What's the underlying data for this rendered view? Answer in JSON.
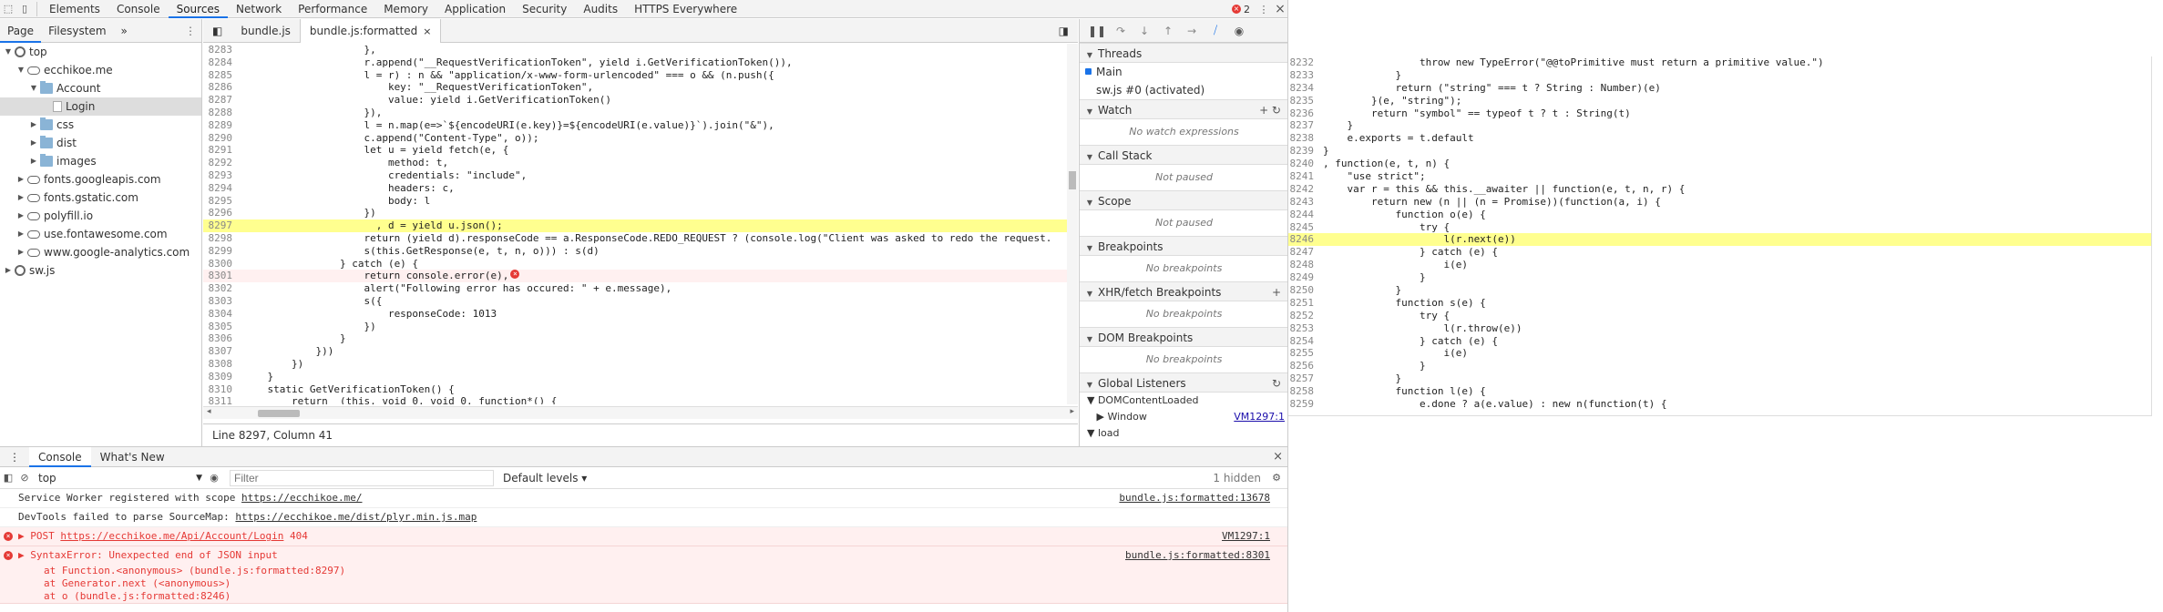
{
  "tabs": [
    "Elements",
    "Console",
    "Sources",
    "Network",
    "Performance",
    "Memory",
    "Application",
    "Security",
    "Audits",
    "HTTPS Everywhere"
  ],
  "active_tab": "Sources",
  "error_count": "2",
  "navigator": {
    "tabs": [
      "Page",
      "Filesystem"
    ],
    "more": "»",
    "tree": [
      {
        "label": "top",
        "depth": 0,
        "icon": "gear-icon",
        "open": true
      },
      {
        "label": "ecchikoe.me",
        "depth": 1,
        "icon": "cloud-icon",
        "open": true
      },
      {
        "label": "Account",
        "depth": 2,
        "icon": "folder-icon",
        "open": true
      },
      {
        "label": "Login",
        "depth": 3,
        "icon": "file-icon",
        "open": false,
        "selected": true
      },
      {
        "label": "css",
        "depth": 2,
        "icon": "folder-icon",
        "open": false
      },
      {
        "label": "dist",
        "depth": 2,
        "icon": "folder-icon",
        "open": false
      },
      {
        "label": "images",
        "depth": 2,
        "icon": "folder-icon",
        "open": false
      },
      {
        "label": "fonts.googleapis.com",
        "depth": 1,
        "icon": "cloud-icon",
        "open": false
      },
      {
        "label": "fonts.gstatic.com",
        "depth": 1,
        "icon": "cloud-icon",
        "open": false
      },
      {
        "label": "polyfill.io",
        "depth": 1,
        "icon": "cloud-icon",
        "open": false
      },
      {
        "label": "use.fontawesome.com",
        "depth": 1,
        "icon": "cloud-icon",
        "open": false
      },
      {
        "label": "www.google-analytics.com",
        "depth": 1,
        "icon": "cloud-icon",
        "open": false
      },
      {
        "label": "sw.js",
        "depth": 0,
        "icon": "gear-icon",
        "open": false
      }
    ]
  },
  "editor": {
    "tabs": [
      {
        "label": "bundle.js",
        "active": false
      },
      {
        "label": "bundle.js:formatted",
        "active": true,
        "close": "×"
      }
    ],
    "status": "Line 8297, Column 41",
    "lines": [
      {
        "n": "8283",
        "t": "                    },"
      },
      {
        "n": "8284",
        "t": "                    r.append(\"__RequestVerificationToken\", yield i.GetVerificationToken()),"
      },
      {
        "n": "8285",
        "t": "                    l = r) : n && \"application/x-www-form-urlencoded\" === o && (n.push({"
      },
      {
        "n": "8286",
        "t": "                        key: \"__RequestVerificationToken\","
      },
      {
        "n": "8287",
        "t": "                        value: yield i.GetVerificationToken()"
      },
      {
        "n": "8288",
        "t": "                    }),"
      },
      {
        "n": "8289",
        "t": "                    l = n.map(e=>`${encodeURI(e.key)}=${encodeURI(e.value)}`).join(\"&\"),"
      },
      {
        "n": "8290",
        "t": "                    c.append(\"Content-Type\", o));"
      },
      {
        "n": "8291",
        "t": "                    let u = yield fetch(e, {"
      },
      {
        "n": "8292",
        "t": "                        method: t,"
      },
      {
        "n": "8293",
        "t": "                        credentials: \"include\","
      },
      {
        "n": "8294",
        "t": "                        headers: c,"
      },
      {
        "n": "8295",
        "t": "                        body: l"
      },
      {
        "n": "8296",
        "t": "                    })"
      },
      {
        "n": "8297",
        "t": "                      , d = yield u.json();",
        "hl": true
      },
      {
        "n": "8298",
        "t": "                    return (yield d).responseCode == a.ResponseCode.REDO_REQUEST ? (console.log(\"Client was asked to redo the request."
      },
      {
        "n": "8299",
        "t": "                    s(this.GetResponse(e, t, n, o))) : s(d)"
      },
      {
        "n": "8300",
        "t": "                } catch (e) {"
      },
      {
        "n": "8301",
        "t": "                    return console.error(e),",
        "err": true
      },
      {
        "n": "8302",
        "t": "                    alert(\"Following error has occured: \" + e.message),"
      },
      {
        "n": "8303",
        "t": "                    s({"
      },
      {
        "n": "8304",
        "t": "                        responseCode: 1013"
      },
      {
        "n": "8305",
        "t": "                    })"
      },
      {
        "n": "8306",
        "t": "                }"
      },
      {
        "n": "8307",
        "t": "            }))"
      },
      {
        "n": "8308",
        "t": "        })"
      },
      {
        "n": "8309",
        "t": "    }"
      },
      {
        "n": "8310",
        "t": "    static GetVerificationToken() {"
      },
      {
        "n": "8311",
        "t": "        return _(this, void 0, void 0, function*() {"
      }
    ]
  },
  "debugger": {
    "threads_title": "Threads",
    "threads": [
      "Main",
      "sw.js #0 (activated)"
    ],
    "sections": [
      {
        "title": "Watch",
        "empty": "No watch expressions",
        "actions": "+ ↻"
      },
      {
        "title": "Call Stack",
        "empty": "Not paused",
        "actions": ""
      },
      {
        "title": "Scope",
        "empty": "Not paused",
        "actions": ""
      },
      {
        "title": "Breakpoints",
        "empty": "No breakpoints",
        "actions": ""
      },
      {
        "title": "XHR/fetch Breakpoints",
        "empty": "No breakpoints",
        "actions": "+"
      },
      {
        "title": "DOM Breakpoints",
        "empty": "No breakpoints",
        "actions": ""
      }
    ],
    "global_title": "Global Listeners",
    "global": [
      {
        "label": "▼ DOMContentLoaded",
        "link": ""
      },
      {
        "label": "   ▶ Window",
        "link": "VM1297:1"
      },
      {
        "label": "▼ load",
        "link": ""
      }
    ]
  },
  "drawer": {
    "tabs": [
      "Console",
      "What's New"
    ],
    "context": "top",
    "filter_placeholder": "Filter",
    "levels": "Default levels ▾",
    "hidden": "1 hidden",
    "messages": [
      {
        "type": "info",
        "prefix": "Service Worker registered with scope ",
        "link": "https://ecchikoe.me/",
        "suffix": "",
        "src": "bundle.js:formatted:13678"
      },
      {
        "type": "warn",
        "prefix": "DevTools failed to parse SourceMap: ",
        "link": "https://ecchikoe.me/dist/plyr.min.js.map",
        "suffix": "",
        "src": ""
      },
      {
        "type": "error",
        "prefix": "▶ POST ",
        "link": "https://ecchikoe.me/Api/Account/Login",
        "suffix": " 404",
        "src": "VM1297:1"
      },
      {
        "type": "error",
        "prefix": "▶ SyntaxError: Unexpected end of JSON input",
        "link": "",
        "suffix": "",
        "src": "bundle.js:formatted:8301",
        "stack": [
          "at Function.<anonymous> (bundle.js:formatted:8297)",
          "at Generator.next (<anonymous>)",
          "at o (bundle.js:formatted:8246)"
        ]
      }
    ]
  },
  "pane2": {
    "lines": [
      {
        "n": "8232",
        "t": "                throw new TypeError(\"@@toPrimitive must return a primitive value.\")"
      },
      {
        "n": "8233",
        "t": "            }"
      },
      {
        "n": "8234",
        "t": "            return (\"string\" === t ? String : Number)(e)"
      },
      {
        "n": "8235",
        "t": "        }(e, \"string\");"
      },
      {
        "n": "8236",
        "t": "        return \"symbol\" == typeof t ? t : String(t)"
      },
      {
        "n": "8237",
        "t": "    }"
      },
      {
        "n": "8238",
        "t": "    e.exports = t.default"
      },
      {
        "n": "8239",
        "t": "}"
      },
      {
        "n": "8240",
        "t": ", function(e, t, n) {"
      },
      {
        "n": "8241",
        "t": "    \"use strict\";"
      },
      {
        "n": "8242",
        "t": "    var r = this && this.__awaiter || function(e, t, n, r) {"
      },
      {
        "n": "8243",
        "t": "        return new (n || (n = Promise))(function(a, i) {"
      },
      {
        "n": "8244",
        "t": "            function o(e) {"
      },
      {
        "n": "8245",
        "t": "                try {"
      },
      {
        "n": "8246",
        "t": "                    l(r.next(e))",
        "hl": true
      },
      {
        "n": "8247",
        "t": "                } catch (e) {"
      },
      {
        "n": "8248",
        "t": "                    i(e)"
      },
      {
        "n": "8249",
        "t": "                }"
      },
      {
        "n": "8250",
        "t": "            }"
      },
      {
        "n": "8251",
        "t": "            function s(e) {"
      },
      {
        "n": "8252",
        "t": "                try {"
      },
      {
        "n": "8253",
        "t": "                    l(r.throw(e))"
      },
      {
        "n": "8254",
        "t": "                } catch (e) {"
      },
      {
        "n": "8255",
        "t": "                    i(e)"
      },
      {
        "n": "8256",
        "t": "                }"
      },
      {
        "n": "8257",
        "t": "            }"
      },
      {
        "n": "8258",
        "t": "            function l(e) {"
      },
      {
        "n": "8259",
        "t": "                e.done ? a(e.value) : new n(function(t) {"
      }
    ]
  }
}
